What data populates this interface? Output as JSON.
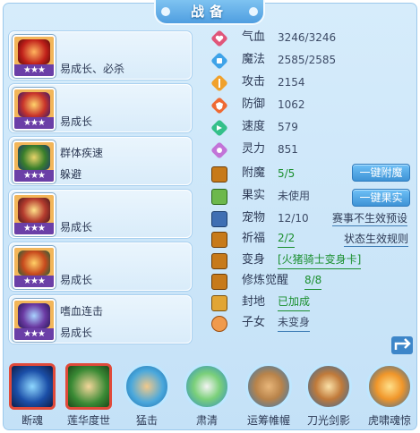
{
  "header": {
    "title": "战备"
  },
  "equipment": [
    {
      "stars": "★★★",
      "line1": "易成长、必杀",
      "line2": "",
      "art": "#c0201a"
    },
    {
      "stars": "★★★",
      "line1": "易成长",
      "line2": "",
      "art": "#c9342a"
    },
    {
      "stars": "★★★",
      "line1": "群体疾速",
      "line2": "躲避",
      "art": "#3a7f2b"
    },
    {
      "stars": "★★★",
      "line1": "易成长",
      "line2": "",
      "art": "#b53c2e"
    },
    {
      "stars": "★★★",
      "line1": "易成长",
      "line2": "",
      "art": "#c84a1d"
    },
    {
      "stars": "★★★",
      "line1": "嗜血连击",
      "line2": "易成长",
      "art": "#6b3aa3"
    }
  ],
  "stats": [
    {
      "label": "气血",
      "value": "3246/3246",
      "icon": "heart-icon",
      "color": "#e0567a"
    },
    {
      "label": "魔法",
      "value": "2585/2585",
      "icon": "mana-icon",
      "color": "#3fa3e8"
    },
    {
      "label": "攻击",
      "value": "2154",
      "icon": "attack-icon",
      "color": "#f0a12c"
    },
    {
      "label": "防御",
      "value": "1062",
      "icon": "defense-icon",
      "color": "#ef6a33"
    },
    {
      "label": "速度",
      "value": "579",
      "icon": "speed-icon",
      "color": "#34c08a"
    },
    {
      "label": "灵力",
      "value": "851",
      "icon": "spirit-icon",
      "color": "#c274d8"
    }
  ],
  "extras": {
    "fumo": {
      "label": "附魔",
      "value": "5/5",
      "button": "一键附魔"
    },
    "guoshi": {
      "label": "果实",
      "value": "未使用",
      "button": "一键果实"
    },
    "chongwu": {
      "label": "宠物",
      "value": "12/10",
      "link": "赛事不生效预设"
    },
    "qifu": {
      "label": "祈福",
      "value": "2/2",
      "link": "状态生效规则"
    },
    "bianshen": {
      "label": "变身",
      "value": "[火猪骑士变身卡]"
    },
    "xiulian": {
      "label": "修炼觉醒",
      "value": "8/8"
    },
    "fengdi": {
      "label": "封地",
      "value": "已加成"
    },
    "zinv": {
      "label": "子女",
      "value": "未变身"
    }
  },
  "skills": [
    {
      "name": "断魂",
      "color": "#1b4fa8"
    },
    {
      "name": "莲华度世",
      "color": "#3a8a35"
    },
    {
      "name": "猛击",
      "color": "#3eaee6"
    },
    {
      "name": "肃清",
      "color": "#3eaee6"
    },
    {
      "name": "运筹帷幄",
      "color": "#3eaee6"
    },
    {
      "name": "刀光剑影",
      "color": "#3eaee6"
    },
    {
      "name": "虎啸魂惊",
      "color": "#3eaee6"
    }
  ]
}
